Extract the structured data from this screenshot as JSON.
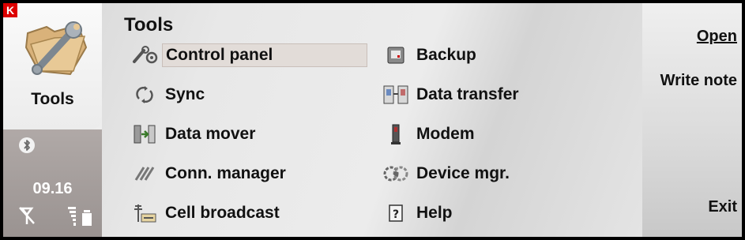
{
  "app": {
    "logo_letter": "K",
    "title": "Tools"
  },
  "status": {
    "time": "09.16",
    "bluetooth_symbol": "ʙ"
  },
  "main": {
    "heading": "Tools",
    "items_left": [
      {
        "label": "Control panel",
        "icon": "control-panel-icon",
        "selected": true
      },
      {
        "label": "Sync",
        "icon": "sync-icon"
      },
      {
        "label": "Data mover",
        "icon": "data-mover-icon"
      },
      {
        "label": "Conn. manager",
        "icon": "conn-manager-icon"
      },
      {
        "label": "Cell broadcast",
        "icon": "cell-broadcast-icon"
      }
    ],
    "items_right": [
      {
        "label": "Backup",
        "icon": "backup-icon"
      },
      {
        "label": "Data transfer",
        "icon": "data-transfer-icon"
      },
      {
        "label": "Modem",
        "icon": "modem-icon"
      },
      {
        "label": "Device mgr.",
        "icon": "device-mgr-icon"
      },
      {
        "label": "Help",
        "icon": "help-icon"
      }
    ]
  },
  "softkeys": {
    "open": "Open",
    "write_note": "Write note",
    "exit": "Exit"
  },
  "colors": {
    "selection": "#e2dcd8",
    "status_pane": "#a39c9a",
    "logo": "#dd0000"
  }
}
